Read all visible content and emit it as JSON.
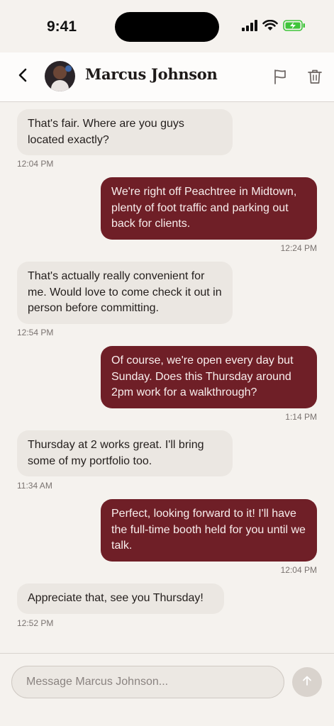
{
  "status": {
    "time": "9:41"
  },
  "header": {
    "contact_name": "Marcus Johnson"
  },
  "messages": [
    {
      "dir": "in",
      "text": "That's fair. Where are you guys located exactly?",
      "time": "12:04 PM"
    },
    {
      "dir": "out",
      "text": "We're right off Peachtree in Midtown, plenty of foot traffic and parking out back for clients.",
      "time": "12:24 PM"
    },
    {
      "dir": "in",
      "text": "That's actually really convenient for me. Would love to come check it out in person before committing.",
      "time": "12:54 PM"
    },
    {
      "dir": "out",
      "text": "Of course, we're open every day but Sunday. Does this Thursday around 2pm work for a walkthrough?",
      "time": "1:14 PM"
    },
    {
      "dir": "in",
      "text": "Thursday at 2 works great. I'll bring some of my portfolio too.",
      "time": "11:34 AM"
    },
    {
      "dir": "out",
      "text": "Perfect, looking forward to it! I'll have the full-time booth held for you until we talk.",
      "time": "12:04 PM"
    },
    {
      "dir": "in",
      "text": "Appreciate that, see you Thursday!",
      "time": "12:52 PM"
    }
  ],
  "composer": {
    "placeholder": "Message Marcus Johnson..."
  },
  "icons": {
    "back": "chevron-left-icon",
    "report": "flag-icon",
    "delete": "trash-icon",
    "send": "arrow-up-icon"
  },
  "colors": {
    "outgoing_bubble": "#6f1f27",
    "incoming_bubble": "#ebe7e2",
    "background": "#f5f2ee",
    "battery": "#3ec43a"
  }
}
